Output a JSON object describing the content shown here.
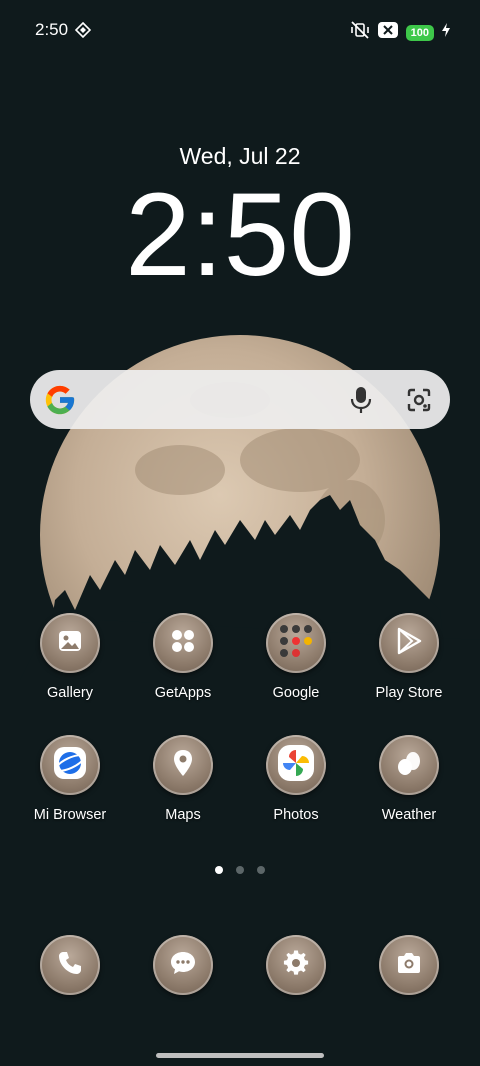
{
  "status_bar": {
    "time": "2:50",
    "battery_level": "100",
    "icons": [
      "vpn-diamond-icon",
      "mute-vibrate-icon",
      "sim-x-icon",
      "charging-bolt-icon"
    ]
  },
  "lockscreen": {
    "date": "Wed, Jul 22",
    "clock": "2:50"
  },
  "search": {
    "icons": [
      "google-g-icon",
      "mic-icon",
      "lens-icon"
    ]
  },
  "apps": [
    {
      "label": "Gallery",
      "icon": "gallery-icon"
    },
    {
      "label": "GetApps",
      "icon": "getapps-icon"
    },
    {
      "label": "Google",
      "icon": "google-folder-icon"
    },
    {
      "label": "Play Store",
      "icon": "play-store-icon"
    },
    {
      "label": "Mi Browser",
      "icon": "mi-browser-icon"
    },
    {
      "label": "Maps",
      "icon": "maps-icon"
    },
    {
      "label": "Photos",
      "icon": "photos-icon"
    },
    {
      "label": "Weather",
      "icon": "weather-icon"
    }
  ],
  "page_indicator": {
    "pages": 3,
    "active": 1
  },
  "dock": [
    {
      "icon": "phone-icon"
    },
    {
      "icon": "messages-icon"
    },
    {
      "icon": "settings-icon"
    },
    {
      "icon": "camera-icon"
    }
  ],
  "colors": {
    "background": "#0f1a1c",
    "moon": "#c9b59f",
    "battery": "#3ec84a",
    "icon_bg": "#8d7b6b"
  }
}
